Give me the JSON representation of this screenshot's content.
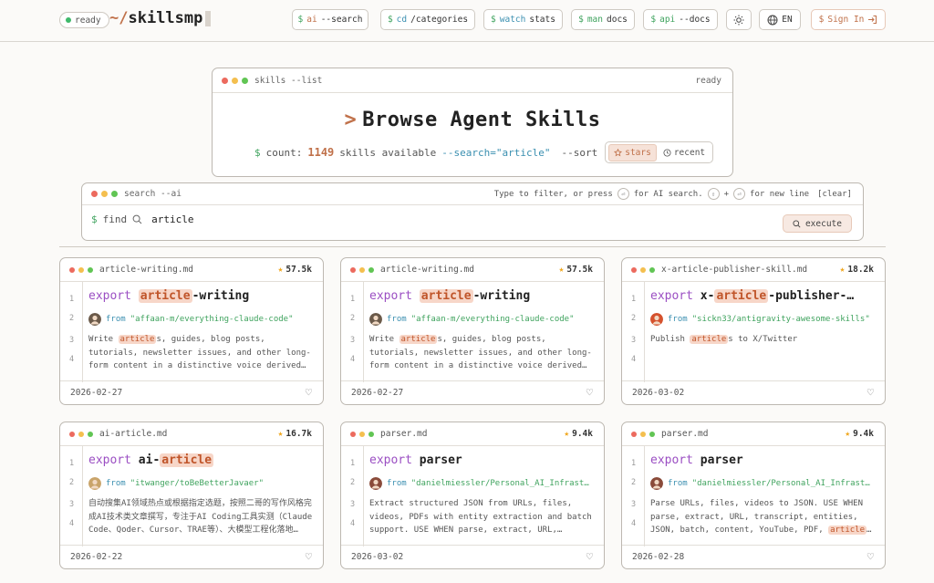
{
  "header": {
    "status": "ready",
    "logo_prefix": "~/",
    "logo_name": "skillsmp",
    "nav": [
      {
        "dollar": "$",
        "cmd": "ai",
        "arg": "--search"
      },
      {
        "dollar": "$",
        "cmd": "cd",
        "arg": "/categories"
      },
      {
        "dollar": "$",
        "cmd": "watch",
        "arg": "stats"
      },
      {
        "dollar": "$",
        "cmd": "man",
        "arg": "docs"
      },
      {
        "dollar": "$",
        "cmd": "api",
        "arg": "--docs"
      }
    ],
    "theme_icon": "sun-icon",
    "lang": "EN",
    "signin": {
      "dollar": "$",
      "label": "Sign In"
    }
  },
  "hero": {
    "bar_title": "skills --list",
    "bar_status": "ready",
    "caret": ">",
    "title": "Browse Agent Skills",
    "count_prefix": "$",
    "count_label": "count:",
    "count": "1149",
    "count_suffix": "skills available",
    "search_arg": "--search=\"article\"",
    "sort_label": "--sort",
    "sort_options": [
      "stars",
      "recent"
    ]
  },
  "search": {
    "bar_title": "search --ai",
    "hint_a": "Type to filter, or press",
    "hint_b": "for AI search.",
    "hint_plus": "+",
    "hint_c": "for new line",
    "clear": "[clear]",
    "prompt": "$",
    "find": "find",
    "value": "article",
    "execute": "execute"
  },
  "cards": [
    {
      "file": "article-writing.md",
      "stars": "57.5k",
      "kw": "export",
      "pre": "",
      "hl": "article",
      "post": "-writing",
      "from": "from",
      "repo": "\"affaan-m/everything-claude-code\"",
      "desc_pre": "Write ",
      "desc_hl": "article",
      "desc_post": "s, guides, blog posts, tutorials, newsletter issues, and other long-form content in a distinctive voice derived…",
      "date": "2026-02-27",
      "avatar": "#6b5a4a"
    },
    {
      "file": "article-writing.md",
      "stars": "57.5k",
      "kw": "export",
      "pre": "",
      "hl": "article",
      "post": "-writing",
      "from": "from",
      "repo": "\"affaan-m/everything-claude-code\"",
      "desc_pre": "Write ",
      "desc_hl": "article",
      "desc_post": "s, guides, blog posts, tutorials, newsletter issues, and other long-form content in a distinctive voice derived…",
      "date": "2026-02-27",
      "avatar": "#6b5a4a"
    },
    {
      "file": "x-article-publisher-skill.md",
      "stars": "18.2k",
      "kw": "export",
      "pre": "x-",
      "hl": "article",
      "post": "-publisher-…",
      "from": "from",
      "repo": "\"sickn33/antigravity-awesome-skills\"",
      "desc_pre": "Publish ",
      "desc_hl": "article",
      "desc_post": "s to X/Twitter",
      "date": "2026-03-02",
      "avatar": "#d5522e"
    },
    {
      "file": "ai-article.md",
      "stars": "16.7k",
      "kw": "export",
      "pre": "ai-",
      "hl": "article",
      "post": "",
      "from": "from",
      "repo": "\"itwanger/toBeBetterJavaer\"",
      "desc_pre": "自动搜集AI领域热点或根据指定选题，按照二哥的写作风格完成AI技术类文章撰写，专注于AI Coding工具实测（Claude Code、Qoder、Cursor、TRAE等）、大模型工程化落地…",
      "desc_hl": "",
      "desc_post": "",
      "date": "2026-02-22",
      "avatar": "#c9a46a"
    },
    {
      "file": "parser.md",
      "stars": "9.4k",
      "kw": "export",
      "pre": "parser",
      "hl": "",
      "post": "",
      "from": "from",
      "repo": "\"danielmiessler/Personal_AI_Infrast…",
      "desc_pre": "Extract structured JSON from URLs, files, videos, PDFs with entity extraction and batch support. USE WHEN parse, extract, URL,…",
      "desc_hl": "",
      "desc_post": "",
      "date": "2026-03-02",
      "avatar": "#8a4b3a"
    },
    {
      "file": "parser.md",
      "stars": "9.4k",
      "kw": "export",
      "pre": "parser",
      "hl": "",
      "post": "",
      "from": "from",
      "repo": "\"danielmiessler/Personal_AI_Infrast…",
      "desc_pre": "Parse URLs, files, videos to JSON. USE WHEN parse, extract, URL, transcript, entities, JSON, batch, content, YouTube, PDF, ",
      "desc_hl": "article",
      "desc_post": "…",
      "date": "2026-02-28",
      "avatar": "#8a4b3a"
    }
  ],
  "line_numbers": [
    "1",
    "2",
    "3",
    "4"
  ]
}
